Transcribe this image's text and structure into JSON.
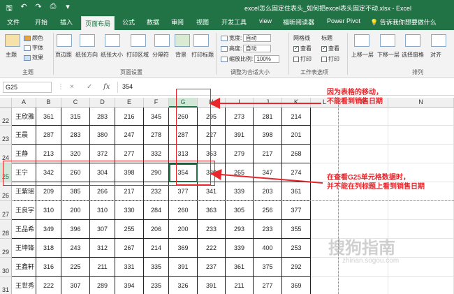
{
  "window": {
    "title": "excel怎么固定住表头_如何把excel表头固定不动.xlsx - Excel"
  },
  "tabs": [
    "文件",
    "开始",
    "插入",
    "页面布局",
    "公式",
    "数据",
    "审阅",
    "视图",
    "开发工具",
    "view",
    "福昕阅读器",
    "Power Pivot",
    "告诉我你想要做什么"
  ],
  "ribbon": {
    "theme": {
      "main": "主题",
      "colors": "颜色",
      "fonts": "字体",
      "effects": "效果",
      "group": "主题"
    },
    "page_setup": {
      "margins": "页边距",
      "orientation": "纸张方向",
      "size": "纸张大小",
      "print_area": "打印区域",
      "breaks": "分隔符",
      "background": "背景",
      "print_titles": "打印标题",
      "group": "页面设置"
    },
    "scale": {
      "width_label": "宽度:",
      "width_value": "自动",
      "height_label": "高度:",
      "height_value": "自动",
      "scale_label": "缩放比例:",
      "scale_value": "100%",
      "group": "调整为合适大小"
    },
    "sheet_options": {
      "gridlines": "网格线",
      "headings": "标题",
      "view": "查看",
      "print": "打印",
      "group": "工作表选项"
    },
    "arrange": {
      "bring_forward": "上移一层",
      "send_backward": "下移一层",
      "selection_pane": "选择窗格",
      "align": "对齐",
      "group": "排列"
    }
  },
  "formula_bar": {
    "name_box": "G25",
    "value": "354",
    "cancel": "×",
    "enter": "✓",
    "fx": "fx"
  },
  "columns": [
    "A",
    "B",
    "C",
    "D",
    "E",
    "F",
    "G",
    "H",
    "I",
    "J",
    "K",
    "L",
    "M",
    "N"
  ],
  "rows": [
    {
      "num": "22",
      "cells": [
        "王欣雅",
        "361",
        "315",
        "283",
        "216",
        "345",
        "260",
        "295",
        "273",
        "281",
        "214"
      ]
    },
    {
      "num": "23",
      "cells": [
        "王晨",
        "287",
        "283",
        "380",
        "247",
        "278",
        "287",
        "227",
        "391",
        "398",
        "201"
      ]
    },
    {
      "num": "24",
      "cells": [
        "王静",
        "213",
        "320",
        "372",
        "277",
        "332",
        "313",
        "363",
        "279",
        "217",
        "268"
      ]
    },
    {
      "num": "25",
      "cells": [
        "王宁",
        "342",
        "260",
        "304",
        "398",
        "290",
        "354",
        "330",
        "265",
        "347",
        "274"
      ]
    },
    {
      "num": "26",
      "cells": [
        "王紫瑶",
        "209",
        "385",
        "266",
        "217",
        "232",
        "377",
        "341",
        "339",
        "203",
        "361"
      ]
    },
    {
      "num": "27",
      "cells": [
        "王良宇",
        "310",
        "200",
        "310",
        "330",
        "284",
        "260",
        "363",
        "305",
        "256",
        "377"
      ]
    },
    {
      "num": "28",
      "cells": [
        "王品希",
        "349",
        "396",
        "307",
        "255",
        "206",
        "200",
        "233",
        "293",
        "233",
        "355"
      ]
    },
    {
      "num": "29",
      "cells": [
        "王坤锋",
        "318",
        "243",
        "312",
        "267",
        "214",
        "369",
        "222",
        "339",
        "400",
        "253"
      ]
    },
    {
      "num": "30",
      "cells": [
        "王鑫轩",
        "316",
        "225",
        "211",
        "331",
        "335",
        "391",
        "237",
        "361",
        "375",
        "292"
      ]
    },
    {
      "num": "31",
      "cells": [
        "王世秀",
        "222",
        "307",
        "289",
        "394",
        "235",
        "326",
        "391",
        "211",
        "277",
        "369"
      ]
    }
  ],
  "annotations": {
    "top": [
      "因为表格的移动，",
      "不能看到销售日期"
    ],
    "bottom": [
      "在查看G25单元格数据时，",
      "并不能在列标题上看到销售日期"
    ]
  },
  "watermark": {
    "main": "搜狗指南",
    "sub": "zhinan.sogou.com"
  },
  "colors": {
    "excel_green": "#217346",
    "annotation_red": "#e8262b"
  }
}
